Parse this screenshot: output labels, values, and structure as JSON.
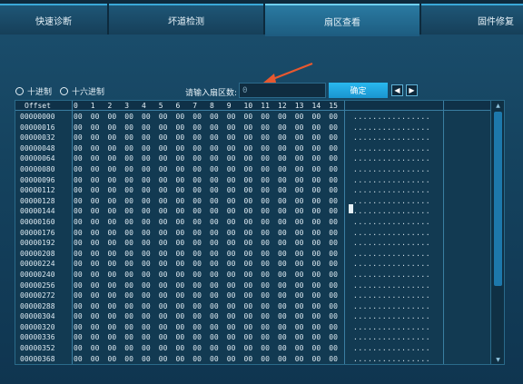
{
  "tabs": [
    {
      "label": "快速诊断",
      "active": false
    },
    {
      "label": "坏道检测",
      "active": false
    },
    {
      "label": "扇区查看",
      "active": true
    },
    {
      "label": "固件修复",
      "active": false
    }
  ],
  "options": {
    "decimal_label": "十进制",
    "hex_label": "十六进制",
    "prompt": "请输入扇区数:",
    "sector_value": "0",
    "confirm_label": "确定",
    "prev_icon": "◀",
    "next_icon": "▶"
  },
  "table": {
    "offset_header": "Offset",
    "columns": [
      "0",
      "1",
      "2",
      "3",
      "4",
      "5",
      "6",
      "7",
      "8",
      "9",
      "10",
      "11",
      "12",
      "13",
      "14",
      "15"
    ],
    "rows": [
      "00000000",
      "00000016",
      "00000032",
      "00000048",
      "00000064",
      "00000080",
      "00000096",
      "00000112",
      "00000128",
      "00000144",
      "00000160",
      "00000176",
      "00000192",
      "00000208",
      "00000224",
      "00000240",
      "00000256",
      "00000272",
      "00000288",
      "00000304",
      "00000320",
      "00000336",
      "00000352",
      "00000368"
    ],
    "byte": "00",
    "ascii": "................"
  },
  "colors": {
    "accent": "#29b8ef",
    "arrow": "#e8582f"
  },
  "icons": {
    "scroll_up": "▲",
    "scroll_down": "▼"
  }
}
